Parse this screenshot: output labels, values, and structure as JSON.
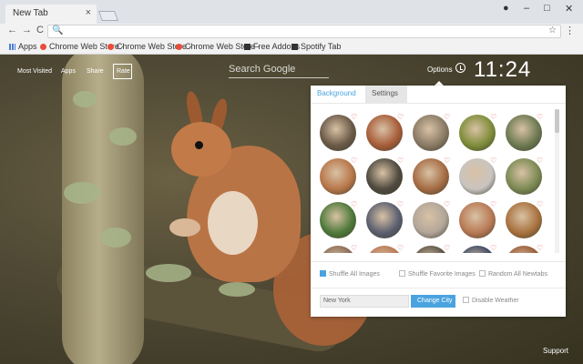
{
  "browser": {
    "tab_title": "New Tab",
    "tab_close": "×",
    "window_controls": [
      "–",
      "□",
      "✕"
    ],
    "nav": {
      "back": "←",
      "forward": "→",
      "reload": "C"
    },
    "menu": "⋮",
    "star": "☆",
    "search_glyph": "🔍",
    "bookmarks": [
      "Apps",
      "Chrome Web Store -",
      "Chrome Web Store -",
      "Chrome Web Store -",
      "Free Addons",
      "Spotify Tab"
    ]
  },
  "page": {
    "nav": [
      "Most Visited",
      "Apps",
      "Share"
    ],
    "rate": "Rate",
    "search_placeholder": "Search Google",
    "options": "Options",
    "time": "11:24",
    "support": "Support"
  },
  "panel": {
    "tabs": [
      "Background",
      "Settings"
    ],
    "active_tab": "Background",
    "thumbnail_colors": [
      "#6b5a48",
      "#a85d3a",
      "#8a7b66",
      "#7f8d3a",
      "#6d7a52",
      "#b8774a",
      "#4f4a3f",
      "#a56c44",
      "#c9c4c0",
      "#7c8a54",
      "#4f7a3b",
      "#5b5f70",
      "#b2a69a",
      "#b97a55",
      "#a9723f",
      "#8c6d57",
      "#b97a56",
      "#5d5648",
      "#3d4a65",
      "#9a5d3a"
    ],
    "options": [
      {
        "label": "Shuffle All Images",
        "checked": true
      },
      {
        "label": "Shuffle Favorite Images",
        "checked": false
      },
      {
        "label": "Random All Newtabs",
        "checked": false
      }
    ],
    "city_value": "New York",
    "change_city": "Change City",
    "disable_weather": "Disable Weather"
  },
  "colors": {
    "accent": "#4aa3df",
    "heart": "#e05a5a"
  }
}
